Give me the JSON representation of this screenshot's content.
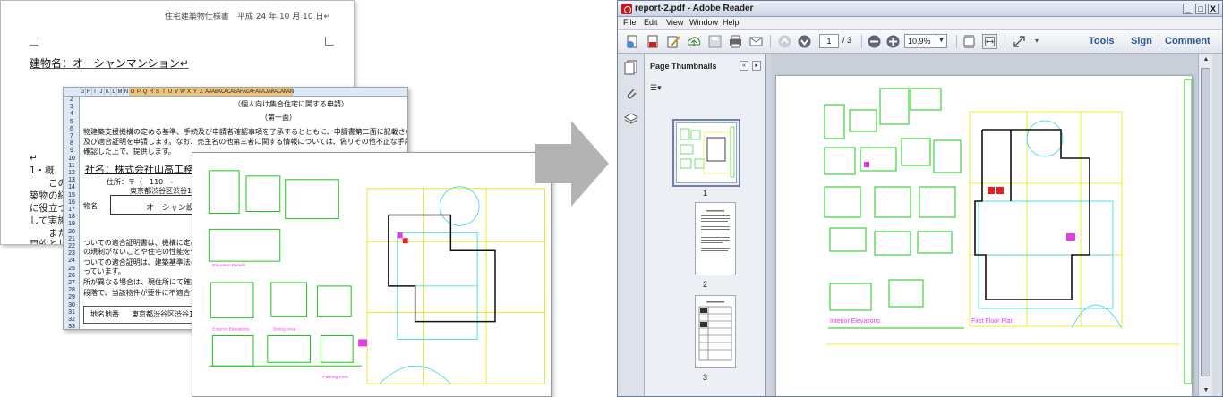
{
  "word_document": {
    "header": "住宅建築物仕様書　平成 24 年 10 月 10 日↵",
    "title": "建物名：オーシャンマンション↵",
    "lines": [
      "↵",
      "1・概",
      "　　このオ",
      "築物の経年",
      "に役立つ",
      "して実施",
      "　　また",
      "目的として"
    ]
  },
  "spreadsheet": {
    "columns": [
      "G",
      "H",
      "I",
      "J",
      "K",
      "L",
      "M",
      "N",
      "O",
      "P",
      "Q",
      "R",
      "S",
      "T",
      "U",
      "V",
      "W",
      "X",
      "Y",
      "Z",
      "AA",
      "AB",
      "AC",
      "AD",
      "AE",
      "AF",
      "AG",
      "AH",
      "AI",
      "AJ",
      "AK",
      "AL",
      "AM",
      "AN"
    ],
    "rows": [
      "2",
      "3",
      "4",
      "5",
      "6",
      "7",
      "8",
      "9",
      "10",
      "11",
      "12",
      "13",
      "14",
      "15",
      "16",
      "17",
      "18",
      "19",
      "20",
      "21",
      "22",
      "23",
      "24",
      "25",
      "26",
      "27",
      "28",
      "29",
      "30",
      "31",
      "32",
      "33"
    ],
    "heading": "（個人向け集合住宅に関する申請）",
    "subheading": "（第一面）",
    "paragraph1": "物建築支援機構の定める基準、手続及び申請者確認事項を了承するとともに、申請書第二面に記載された個人情報の",
    "paragraph2": "及び適合証明を申請します。なお、売主名の他第三者に関する情報については、偽りその他不正な手段によ",
    "paragraph3": "確認した上で、提供します。",
    "company": "社名：株式会社山高工務店",
    "address_label": "住所：〒（　110　-",
    "address": "東京都渋谷区渋谷1-2-",
    "building_label": "物名",
    "building_value": "オーシャン設",
    "notes": [
      "ついての適合証明書は、機構に定める物件",
      "の規制がないことや住宅の性能を保証するも",
      "ついての適合証明は、建築基準法への適合証明",
      "っています。",
      "所が異なる場合は、現住所にて確認します。",
      "段階で、当該物件が要件に不適合であることが"
    ],
    "table_label": "地名地番",
    "table_value": "東京都渋谷区渋谷1丁"
  },
  "cad_labels": [
    "Interior Elevations",
    "First Floor Plan",
    "Elevation Details",
    "Dining Area",
    "Exterior Elevations",
    "Parking Area"
  ],
  "arrow": {
    "color": "#b3b3b3"
  },
  "reader": {
    "title": "report-2.pdf - Adobe Reader",
    "window_buttons": [
      "_",
      "□",
      "X"
    ],
    "menu": [
      "File",
      "Edit",
      "View",
      "Window",
      "Help"
    ],
    "page_current": "1",
    "page_total": "/ 3",
    "zoom": "10.9%",
    "tools_label": "Tools",
    "sign_label": "Sign",
    "comment_label": "Comment",
    "thumbnails_title": "Page Thumbnails",
    "thumbnails": [
      {
        "label": "1"
      },
      {
        "label": "2"
      },
      {
        "label": "3"
      }
    ],
    "page_labels": {
      "interior": "Interior Elevations",
      "floor": "First Floor Plan"
    },
    "accent_color": "#2e5596"
  }
}
